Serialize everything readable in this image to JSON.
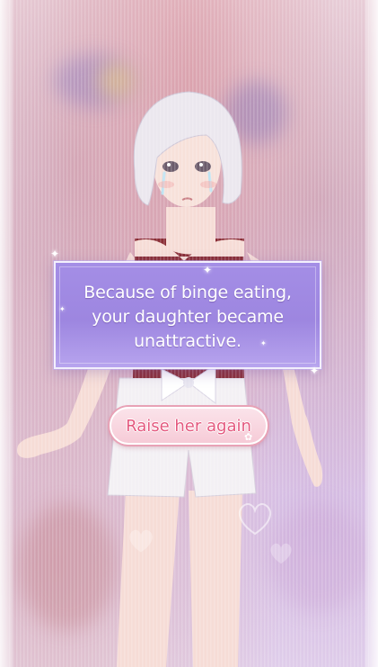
{
  "dialog": {
    "message": "Because of binge eating,\nyour daughter became\nunattractive."
  },
  "buttons": {
    "raise_again": "Raise her again"
  },
  "colors": {
    "dialog_bg": "#a48ee6",
    "button_bg": "#f6cbd7",
    "button_text": "#e4587e"
  }
}
